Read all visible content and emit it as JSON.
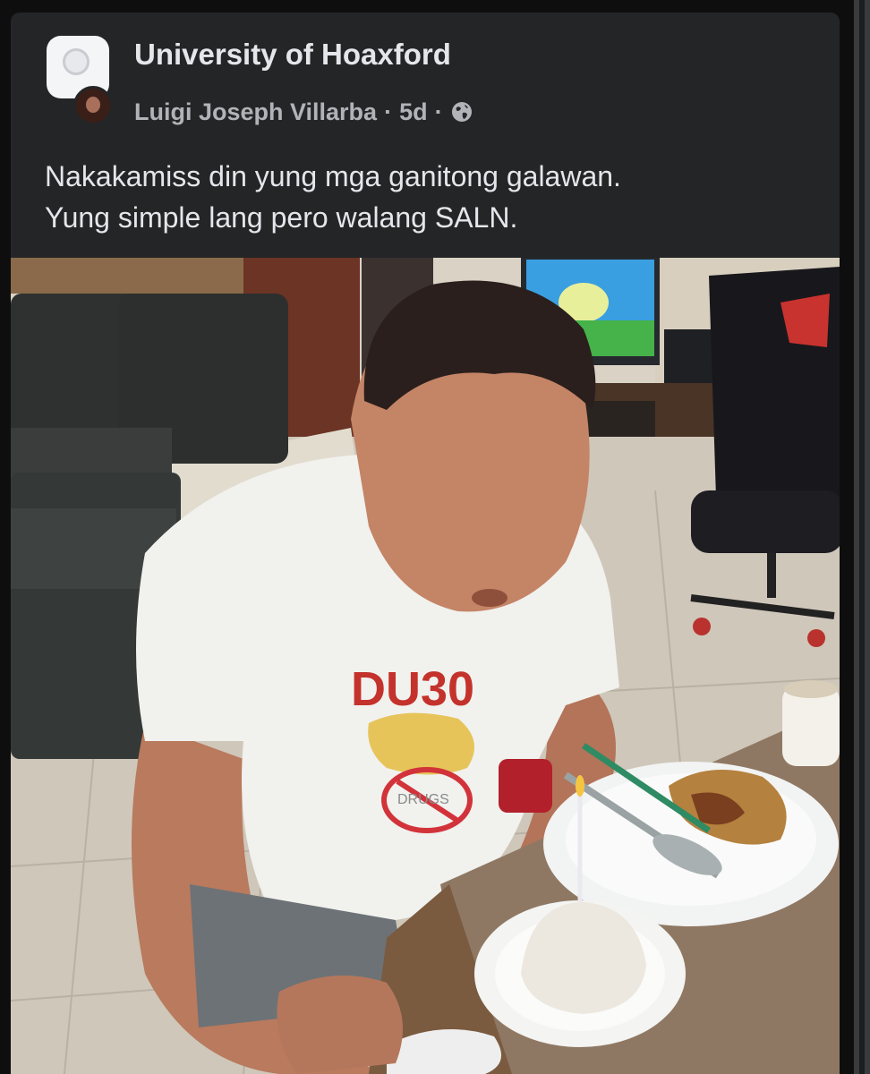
{
  "post": {
    "group_name": "University of Hoaxford",
    "author": "Luigi Joseph Villarba",
    "separator": "·",
    "time_ago": "5d",
    "audience_icon": "globe-icon",
    "text_line_1": "Nakakamiss din yung mga ganitong galawan.",
    "text_line_2": "Yung simple lang pero walang SALN."
  },
  "photo": {
    "shirt_logo": "DU30",
    "shirt_badge": "DRUGS"
  },
  "colors": {
    "card_bg": "#242526",
    "primary_text": "#e4e6eb",
    "secondary_text": "#b0b3b8"
  }
}
